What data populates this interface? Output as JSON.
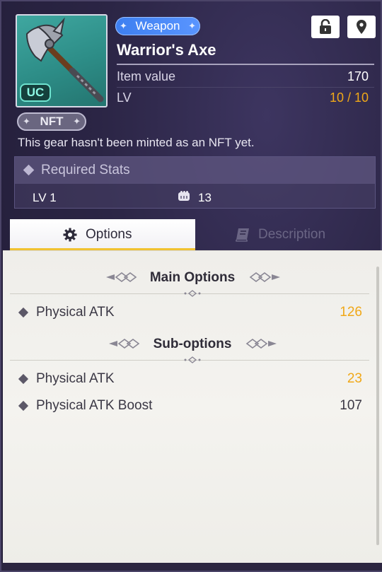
{
  "item": {
    "type_tag": "Weapon",
    "name": "Warrior's Axe",
    "rarity_badge": "UC",
    "thumbnail_icon": "battle-axe-icon",
    "item_value_label": "Item value",
    "item_value": "170",
    "lv_label": "LV",
    "lv_value": "10 / 10"
  },
  "header_buttons": {
    "lock_icon": "unlock-icon",
    "locate_icon": "map-pin-icon"
  },
  "nft": {
    "badge": "NFT",
    "note": "This gear hasn't been minted as an NFT yet."
  },
  "required_stats": {
    "title": "Required Stats",
    "lv_text": "LV  1",
    "strength_icon": "fist-icon",
    "strength_value": "13"
  },
  "tabs": [
    {
      "label": "Options",
      "icon": "gear-icon",
      "active": true
    },
    {
      "label": "Description",
      "icon": "book-icon",
      "active": false
    }
  ],
  "options": {
    "main_title": "Main Options",
    "main": [
      {
        "name": "Physical ATK",
        "value": "126",
        "color": "#f0a818"
      }
    ],
    "sub_title": "Sub-options",
    "sub": [
      {
        "name": "Physical ATK",
        "value": "23",
        "color": "#f0a818"
      },
      {
        "name": "Physical ATK Boost",
        "value": "107",
        "color": "#3a3744"
      }
    ]
  },
  "colors": {
    "accent_gold": "#f0a818",
    "tab_underline": "#f1c232",
    "weapon_tag": "#4a8af8",
    "rarity_teal": "#6fe3cf"
  }
}
